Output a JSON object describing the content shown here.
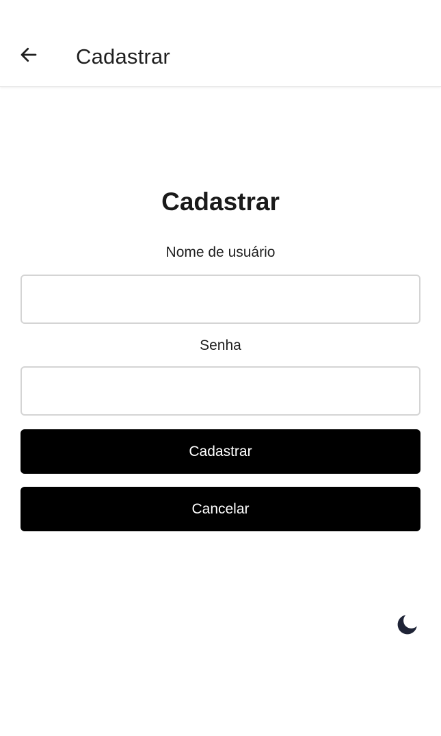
{
  "header": {
    "back_icon": "arrow-left-icon",
    "title": "Cadastrar"
  },
  "form": {
    "title": "Cadastrar",
    "username_label": "Nome de usuário",
    "username_value": "",
    "password_label": "Senha",
    "password_value": "",
    "submit_label": "Cadastrar",
    "cancel_label": "Cancelar"
  },
  "theme_toggle": {
    "icon": "moon-icon",
    "color": "#1e2336"
  },
  "colors": {
    "button_background": "#000000",
    "button_text": "#ffffff",
    "input_border": "#d4d4d4"
  }
}
